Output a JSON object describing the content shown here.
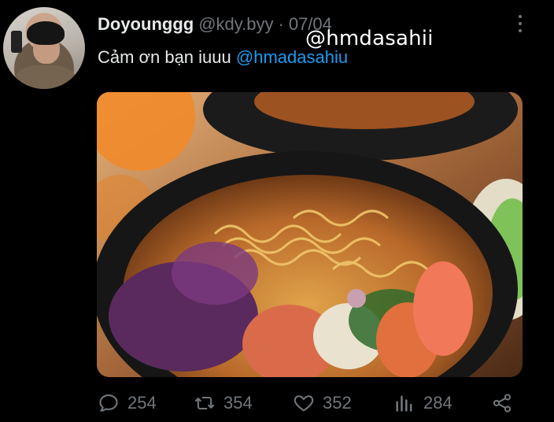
{
  "tweet": {
    "display_name": "Doyounggg",
    "handle": "@kdy.byy",
    "separator": "·",
    "date": "07/04",
    "text_before": "Cảm ơn bạn iuuu ",
    "mention": "@hmadasahiu",
    "overlay_tag": "@hmdasahii",
    "avatar_icon": "profile-photo",
    "media_icon": "ramen-photo"
  },
  "actions": {
    "replies": "254",
    "retweets": "354",
    "likes": "352",
    "views": "284"
  },
  "colors": {
    "background": "#000000",
    "primary_text": "#e7e9ea",
    "secondary_text": "#71767b",
    "accent": "#1d9bf0"
  }
}
